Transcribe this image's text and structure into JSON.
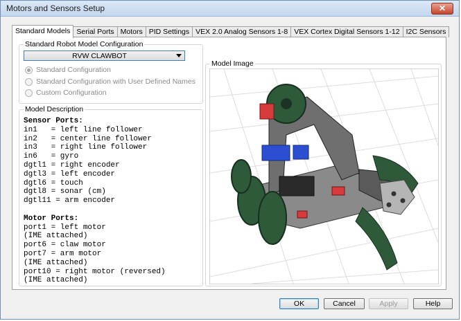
{
  "window": {
    "title": "Motors and Sensors Setup",
    "close_glyph": "✕"
  },
  "tabs": [
    {
      "label": "Standard Models",
      "active": true
    },
    {
      "label": "Serial Ports"
    },
    {
      "label": "Motors"
    },
    {
      "label": "PID Settings"
    },
    {
      "label": "VEX 2.0 Analog Sensors 1-8"
    },
    {
      "label": "VEX Cortex Digital Sensors 1-12"
    },
    {
      "label": "I2C Sensors"
    }
  ],
  "config": {
    "legend": "Standard Robot Model Configuration",
    "selected_model": "RVW CLAWBOT",
    "options": [
      {
        "label": "Standard Configuration",
        "selected": true
      },
      {
        "label": "Standard Configuration with User Defined Names",
        "selected": false
      },
      {
        "label": "Custom Configuration",
        "selected": false
      }
    ]
  },
  "description": {
    "legend": "Model Description",
    "sensor_header": "Sensor Ports:",
    "sensor_lines": [
      "in1   = left line follower",
      "in2   = center line follower",
      "in3   = right line follower",
      "in6   = gyro",
      "dgtl1 = right encoder",
      "dgtl3 = left encoder",
      "dgtl6 = touch",
      "dgtl8 = sonar (cm)",
      "dgtl11 = arm encoder"
    ],
    "motor_header": "Motor Ports:",
    "motor_lines": [
      "port1 = left motor",
      "(IME attached)",
      "port6 = claw motor",
      "port7 = arm motor",
      "(IME attached)",
      "port10 = right motor (reversed)",
      "(IME attached)"
    ]
  },
  "model_image": {
    "legend": "Model Image"
  },
  "buttons": {
    "ok": "OK",
    "cancel": "Cancel",
    "apply": "Apply",
    "help": "Help"
  },
  "colors": {
    "accent": "#3c7fb1",
    "robot_green": "#2f5a3a",
    "robot_metal": "#7a7a7a",
    "robot_red": "#d63a3a",
    "robot_blue": "#2b4fd0"
  }
}
